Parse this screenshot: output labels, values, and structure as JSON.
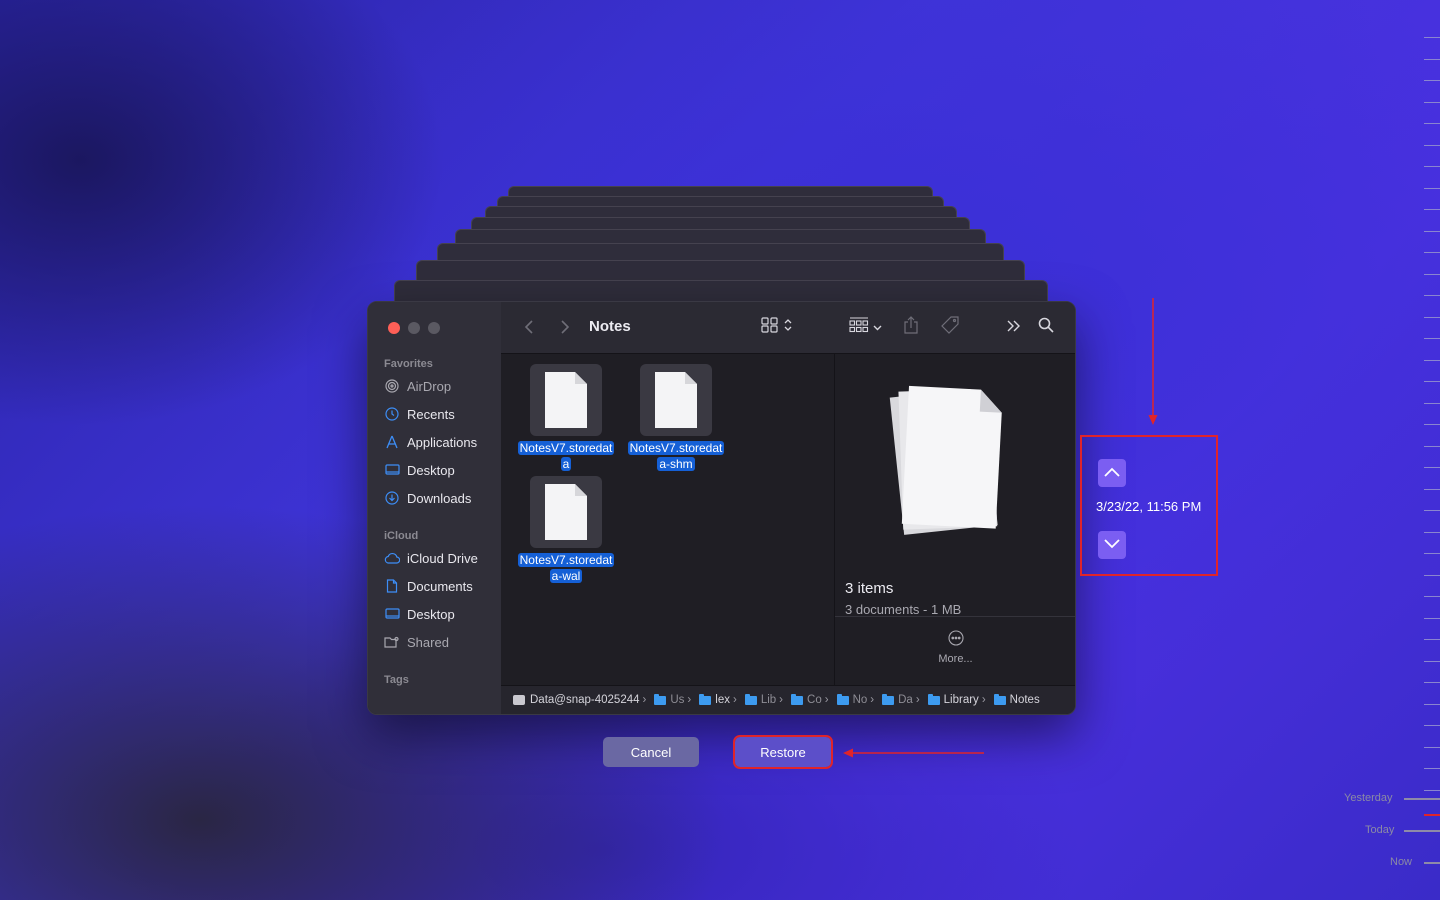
{
  "window": {
    "title": "Notes",
    "sidebar": {
      "favorites_heading": "Favorites",
      "favorites": [
        {
          "label": "AirDrop",
          "icon": "airdrop-icon",
          "dim": true
        },
        {
          "label": "Recents",
          "icon": "clock-icon"
        },
        {
          "label": "Applications",
          "icon": "applications-icon"
        },
        {
          "label": "Desktop",
          "icon": "desktop-icon"
        },
        {
          "label": "Downloads",
          "icon": "download-icon"
        }
      ],
      "icloud_heading": "iCloud",
      "icloud": [
        {
          "label": "iCloud Drive",
          "icon": "cloud-icon"
        },
        {
          "label": "Documents",
          "icon": "document-icon"
        },
        {
          "label": "Desktop",
          "icon": "desktop-icon"
        },
        {
          "label": "Shared",
          "icon": "shared-folder-icon",
          "dim": true
        }
      ],
      "tags_heading": "Tags"
    },
    "files": [
      {
        "line1": "NotesV7.storedat",
        "line2": "a"
      },
      {
        "line1": "NotesV7.storedat",
        "line2": "a-shm"
      },
      {
        "line1": "NotesV7.storedat",
        "line2": "a-wal"
      }
    ],
    "preview": {
      "count": "3 items",
      "detail": "3 documents - 1 MB",
      "more_label": "More..."
    },
    "path": [
      {
        "label": "Data@snap-4025244",
        "kind": "disk"
      },
      {
        "label": "Us",
        "kind": "folder"
      },
      {
        "label": "lex",
        "kind": "folder"
      },
      {
        "label": "Lib",
        "kind": "folder"
      },
      {
        "label": "Co",
        "kind": "folder"
      },
      {
        "label": "No",
        "kind": "folder"
      },
      {
        "label": "Da",
        "kind": "folder"
      },
      {
        "label": "Library",
        "kind": "folder"
      },
      {
        "label": "Notes",
        "kind": "folder"
      }
    ]
  },
  "buttons": {
    "cancel": "Cancel",
    "restore": "Restore"
  },
  "time_machine": {
    "date": "3/23/22, 11:56 PM"
  },
  "timeline": {
    "yesterday": "Yesterday",
    "today": "Today",
    "now": "Now"
  },
  "colors": {
    "accent": "#1560d6",
    "annotation_red": "#e0242a",
    "tm_button": "#7b5ef2"
  }
}
